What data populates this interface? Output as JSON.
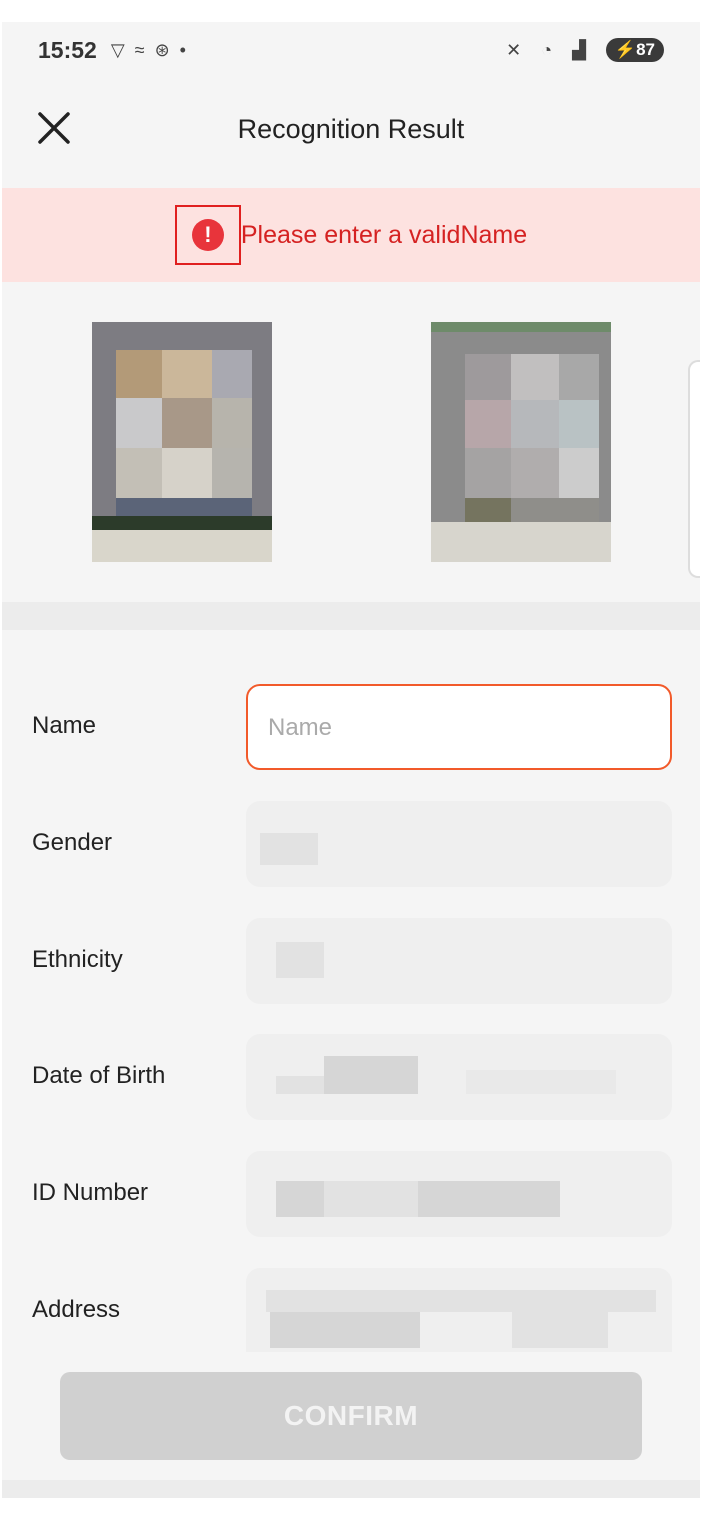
{
  "status_bar": {
    "time": "15:52",
    "battery": "87",
    "icons": [
      "vpn-icon",
      "data-saver-icon",
      "sync-icon",
      "dot-icon",
      "mute-icon",
      "wifi-icon",
      "signal-icon",
      "battery-icon"
    ]
  },
  "header": {
    "title": "Recognition Result",
    "close_icon": "close-icon"
  },
  "error_banner": {
    "icon": "exclamation-circle-icon",
    "text": "Please enter a validName"
  },
  "images": {
    "front": "id-card-front-photo",
    "back": "id-card-back-photo"
  },
  "form": {
    "name": {
      "label": "Name",
      "placeholder": "Name",
      "value": ""
    },
    "gender": {
      "label": "Gender"
    },
    "ethnicity": {
      "label": "Ethnicity"
    },
    "dob": {
      "label": "Date of Birth"
    },
    "id_number": {
      "label": "ID Number"
    },
    "address": {
      "label": "Address"
    }
  },
  "confirm": {
    "label": "CONFIRM"
  },
  "colors": {
    "error_bg": "#fde2e0",
    "error_text": "#d52222",
    "active_border": "#f25a2a",
    "disabled_button": "#d0d0d0"
  }
}
